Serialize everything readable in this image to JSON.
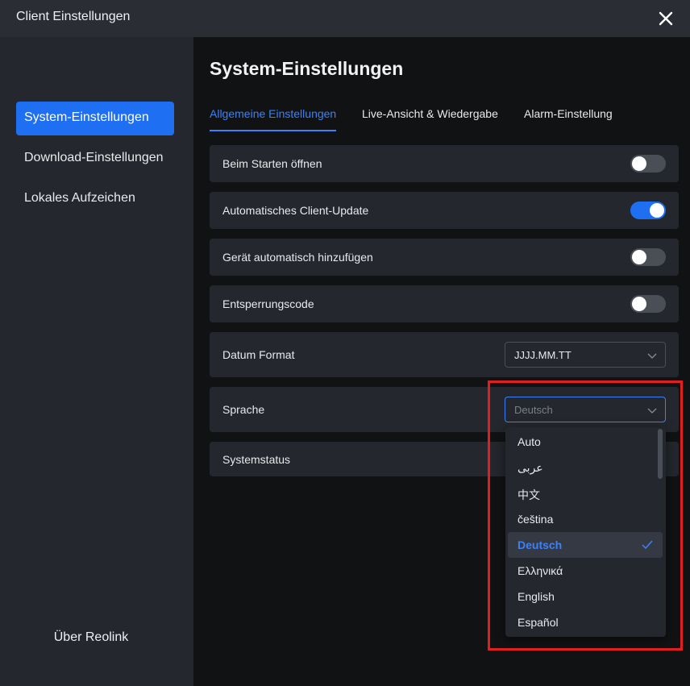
{
  "window": {
    "title": "Client Einstellungen"
  },
  "sidebar": {
    "items": [
      {
        "label": "System-Einstellungen",
        "active": true
      },
      {
        "label": "Download-Einstellungen",
        "active": false
      },
      {
        "label": "Lokales Aufzeichen",
        "active": false
      }
    ],
    "about_label": "Über Reolink"
  },
  "main": {
    "title": "System-Einstellungen",
    "tabs": [
      {
        "label": "Allgemeine Einstellungen",
        "active": true
      },
      {
        "label": "Live-Ansicht & Wiedergabe",
        "active": false
      },
      {
        "label": "Alarm-Einstellung",
        "active": false
      }
    ],
    "settings": [
      {
        "label": "Beim Starten öffnen",
        "type": "toggle",
        "on": false
      },
      {
        "label": "Automatisches Client-Update",
        "type": "toggle",
        "on": true
      },
      {
        "label": "Gerät automatisch hinzufügen",
        "type": "toggle",
        "on": false
      },
      {
        "label": "Entsperrungscode",
        "type": "toggle",
        "on": false
      },
      {
        "label": "Datum Format",
        "type": "select",
        "value": "JJJJ.MM.TT"
      },
      {
        "label": "Sprache",
        "type": "select",
        "value": "Deutsch"
      },
      {
        "label": "Systemstatus",
        "type": "link"
      }
    ],
    "language_dropdown": {
      "options": [
        "Auto",
        "عربى",
        "中文",
        "čeština",
        "Deutsch",
        "Ελληνικά",
        "English",
        "Español"
      ],
      "selected": "Deutsch"
    }
  },
  "colors": {
    "accent": "#1f6ff2",
    "highlight_box": "#e02020"
  }
}
